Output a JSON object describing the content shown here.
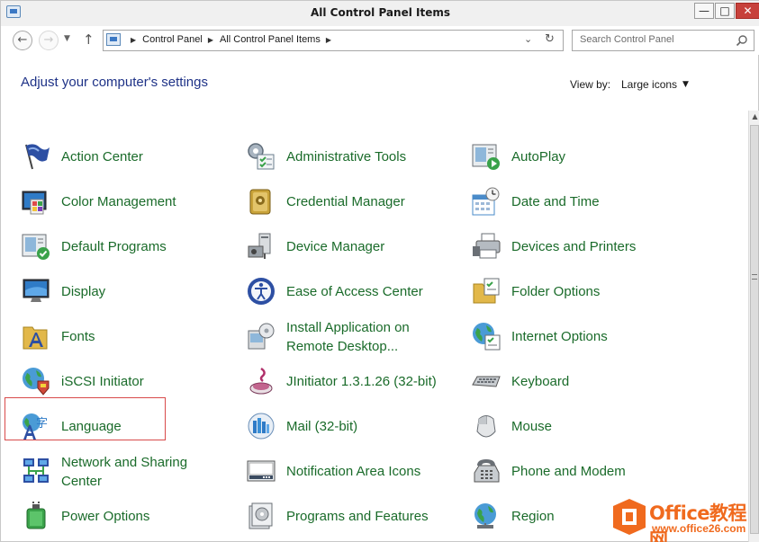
{
  "window": {
    "title": "All Control Panel Items"
  },
  "titlebar_buttons": {
    "minimize": "—",
    "maximize": "□",
    "close": "✕"
  },
  "nav": {
    "back": "←",
    "forward": "→",
    "dropdown": "▼",
    "up": "↑",
    "address": {
      "crumbs": [
        "Control Panel",
        "All Control Panel Items"
      ],
      "separator": "▶"
    },
    "address_dropdown": "⌄",
    "refresh": "↻",
    "search": {
      "placeholder": "Search Control Panel",
      "icon": "search-icon"
    }
  },
  "main": {
    "heading": "Adjust your computer's settings",
    "view_by": {
      "label": "View by:",
      "value": "Large icons",
      "arrow": "▼"
    }
  },
  "items": [
    {
      "label": "Action Center",
      "icon": "flag-icon",
      "color": "#2d4fa3"
    },
    {
      "label": "Administrative Tools",
      "icon": "admin-tools-icon",
      "color": "#6a7c8c"
    },
    {
      "label": "AutoPlay",
      "icon": "autoplay-icon",
      "color": "#3aa24a"
    },
    {
      "label": "Color Management",
      "icon": "color-management-icon",
      "color": "#2f7bc7"
    },
    {
      "label": "Credential Manager",
      "icon": "credential-vault-icon",
      "color": "#c9a33a"
    },
    {
      "label": "Date and Time",
      "icon": "calendar-clock-icon",
      "color": "#4a8bc9"
    },
    {
      "label": "Default Programs",
      "icon": "default-programs-icon",
      "color": "#3aa24a"
    },
    {
      "label": "Device Manager",
      "icon": "device-manager-icon",
      "color": "#6a6f75"
    },
    {
      "label": "Devices and Printers",
      "icon": "printer-icon",
      "color": "#6a6f75"
    },
    {
      "label": "Display",
      "icon": "monitor-icon",
      "color": "#2f7bc7"
    },
    {
      "label": "Ease of Access Center",
      "icon": "ease-of-access-icon",
      "color": "#2d4fa3"
    },
    {
      "label": "Folder Options",
      "icon": "folder-options-icon",
      "color": "#e2b84a"
    },
    {
      "label": "Fonts",
      "icon": "fonts-folder-icon",
      "color": "#e2b84a"
    },
    {
      "label": "Install Application on\nRemote Desktop...",
      "line1": "Install Application on",
      "line2": "Remote Desktop...",
      "icon": "install-remote-icon",
      "color": "#6a6f75"
    },
    {
      "label": "Internet Options",
      "icon": "internet-globe-icon",
      "color": "#2f8f4a"
    },
    {
      "label": "iSCSI Initiator",
      "icon": "iscsi-globe-icon",
      "color": "#2f8f4a"
    },
    {
      "label": "JInitiator 1.3.1.26 (32-bit)",
      "icon": "jinitiator-icon",
      "color": "#b0306a"
    },
    {
      "label": "Keyboard",
      "icon": "keyboard-icon",
      "color": "#6a6f75"
    },
    {
      "label": "Language",
      "icon": "language-icon",
      "color": "#2f7bc7"
    },
    {
      "label": "Mail (32-bit)",
      "icon": "mail-icon",
      "color": "#2f7bc7"
    },
    {
      "label": "Mouse",
      "icon": "mouse-icon",
      "color": "#8a8a8a"
    },
    {
      "label": "Network and Sharing\nCenter",
      "line1": "Network and Sharing",
      "line2": "Center",
      "icon": "network-icon",
      "color": "#2d4fa3"
    },
    {
      "label": "Notification Area Icons",
      "icon": "notification-area-icon",
      "color": "#6a6f75"
    },
    {
      "label": "Phone and Modem",
      "icon": "phone-modem-icon",
      "color": "#6a6f75"
    },
    {
      "label": "Power Options",
      "icon": "power-options-icon",
      "color": "#3aa24a"
    },
    {
      "label": "Programs and Features",
      "icon": "programs-features-icon",
      "color": "#6a6f75"
    },
    {
      "label": "Region",
      "icon": "region-globe-icon",
      "color": "#2f8f4a"
    }
  ],
  "watermark": {
    "title": "Office教程网",
    "url": "www.office26.com"
  },
  "colors": {
    "item_text": "#1a6b2a",
    "heading": "#1e3287",
    "highlight": "#d84a4a",
    "close_button": "#c7413b",
    "watermark": "#f06a1e"
  }
}
